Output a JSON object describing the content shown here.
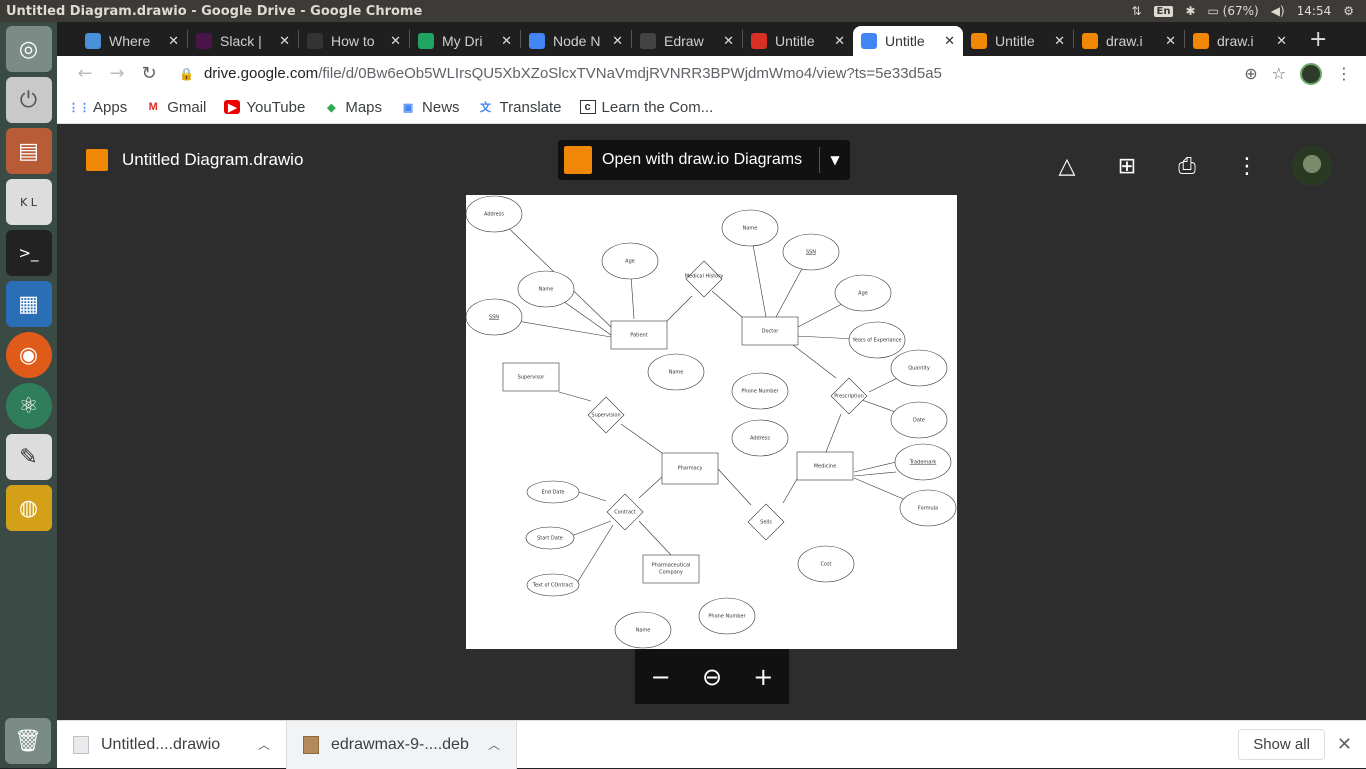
{
  "os": {
    "window_title": "Untitled Diagram.drawio - Google Drive - Google Chrome",
    "keyboard": "En",
    "battery": "(67%)",
    "clock": "14:54"
  },
  "tabs": [
    {
      "label": "Where",
      "color": "#4a90d9"
    },
    {
      "label": "Slack |",
      "color": "#4a154b"
    },
    {
      "label": "How to",
      "color": "#333333"
    },
    {
      "label": "My Dri",
      "color": "#1fa463"
    },
    {
      "label": "Node N",
      "color": "#4285f4"
    },
    {
      "label": "Edraw",
      "color": "#444444"
    },
    {
      "label": "Untitle",
      "color": "#d93025"
    },
    {
      "label": "Untitle",
      "color": "#4285f4"
    },
    {
      "label": "Untitle",
      "color": "#f08705"
    },
    {
      "label": "draw.i",
      "color": "#f08705"
    },
    {
      "label": "draw.i",
      "color": "#f08705"
    }
  ],
  "address": {
    "host": "drive.google.com",
    "path": "/file/d/0Bw6eOb5WLIrsQU5XbXZoSlcxTVNaVmdjRVNRR3BPWjdmWmo4/view?ts=5e33d5a5"
  },
  "bookmarks": [
    "Apps",
    "Gmail",
    "YouTube",
    "Maps",
    "News",
    "Translate",
    "Learn the Com..."
  ],
  "viewer": {
    "file_title": "Untitled Diagram.drawio",
    "open_with": "Open with draw.io Diagrams"
  },
  "diagram": {
    "address_top": "Address",
    "age_patient": "Age",
    "medical_history": "Medical History",
    "name_doctor": "Name",
    "ssn_doctor": "SSN",
    "name_patient": "Name",
    "age_doctor": "Age",
    "ssn_patient": "SSN",
    "patient": "Patient",
    "doctor": "Doctor",
    "years_exp": "Years of Experiance",
    "quantity": "Quantity",
    "supervisor": "Supervisor",
    "name_pharmacy": "Name",
    "phone_pharmacy": "Phone Number",
    "prescription": "Prescription",
    "supervision": "Supervision",
    "date": "Date",
    "address_pharmacy": "Address",
    "trademark": "Trademark",
    "pharmacy": "Pharmacy",
    "medicine": "Medicine",
    "end_date": "End Date",
    "contract": "Contract",
    "formula": "Formula",
    "sells": "Sells",
    "start_date": "Start Date",
    "cost": "Cost",
    "pharma_company_1": "Pharmaceutical",
    "pharma_company_2": "Company",
    "text_contract": "Text of COntract",
    "phone_company": "Phone Number",
    "name_company": "Name"
  },
  "downloads": [
    {
      "name": "Untitled....drawio"
    },
    {
      "name": "edrawmax-9-....deb"
    }
  ],
  "shelf": {
    "show_all": "Show all"
  }
}
